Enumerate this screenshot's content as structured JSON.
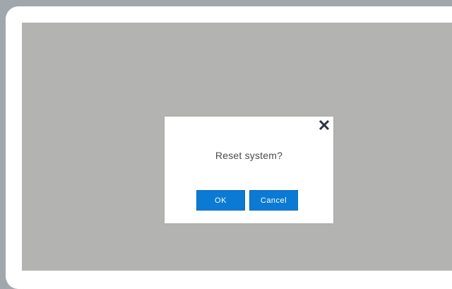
{
  "dialog": {
    "message": "Reset system?",
    "ok_label": "OK",
    "cancel_label": "Cancel",
    "close_icon": "close-icon"
  },
  "colors": {
    "background": "#a0a7ad",
    "frame": "#ffffff",
    "screen": "#b3b4b2",
    "button": "#0a7ad4",
    "close_icon": "#2d3142"
  }
}
